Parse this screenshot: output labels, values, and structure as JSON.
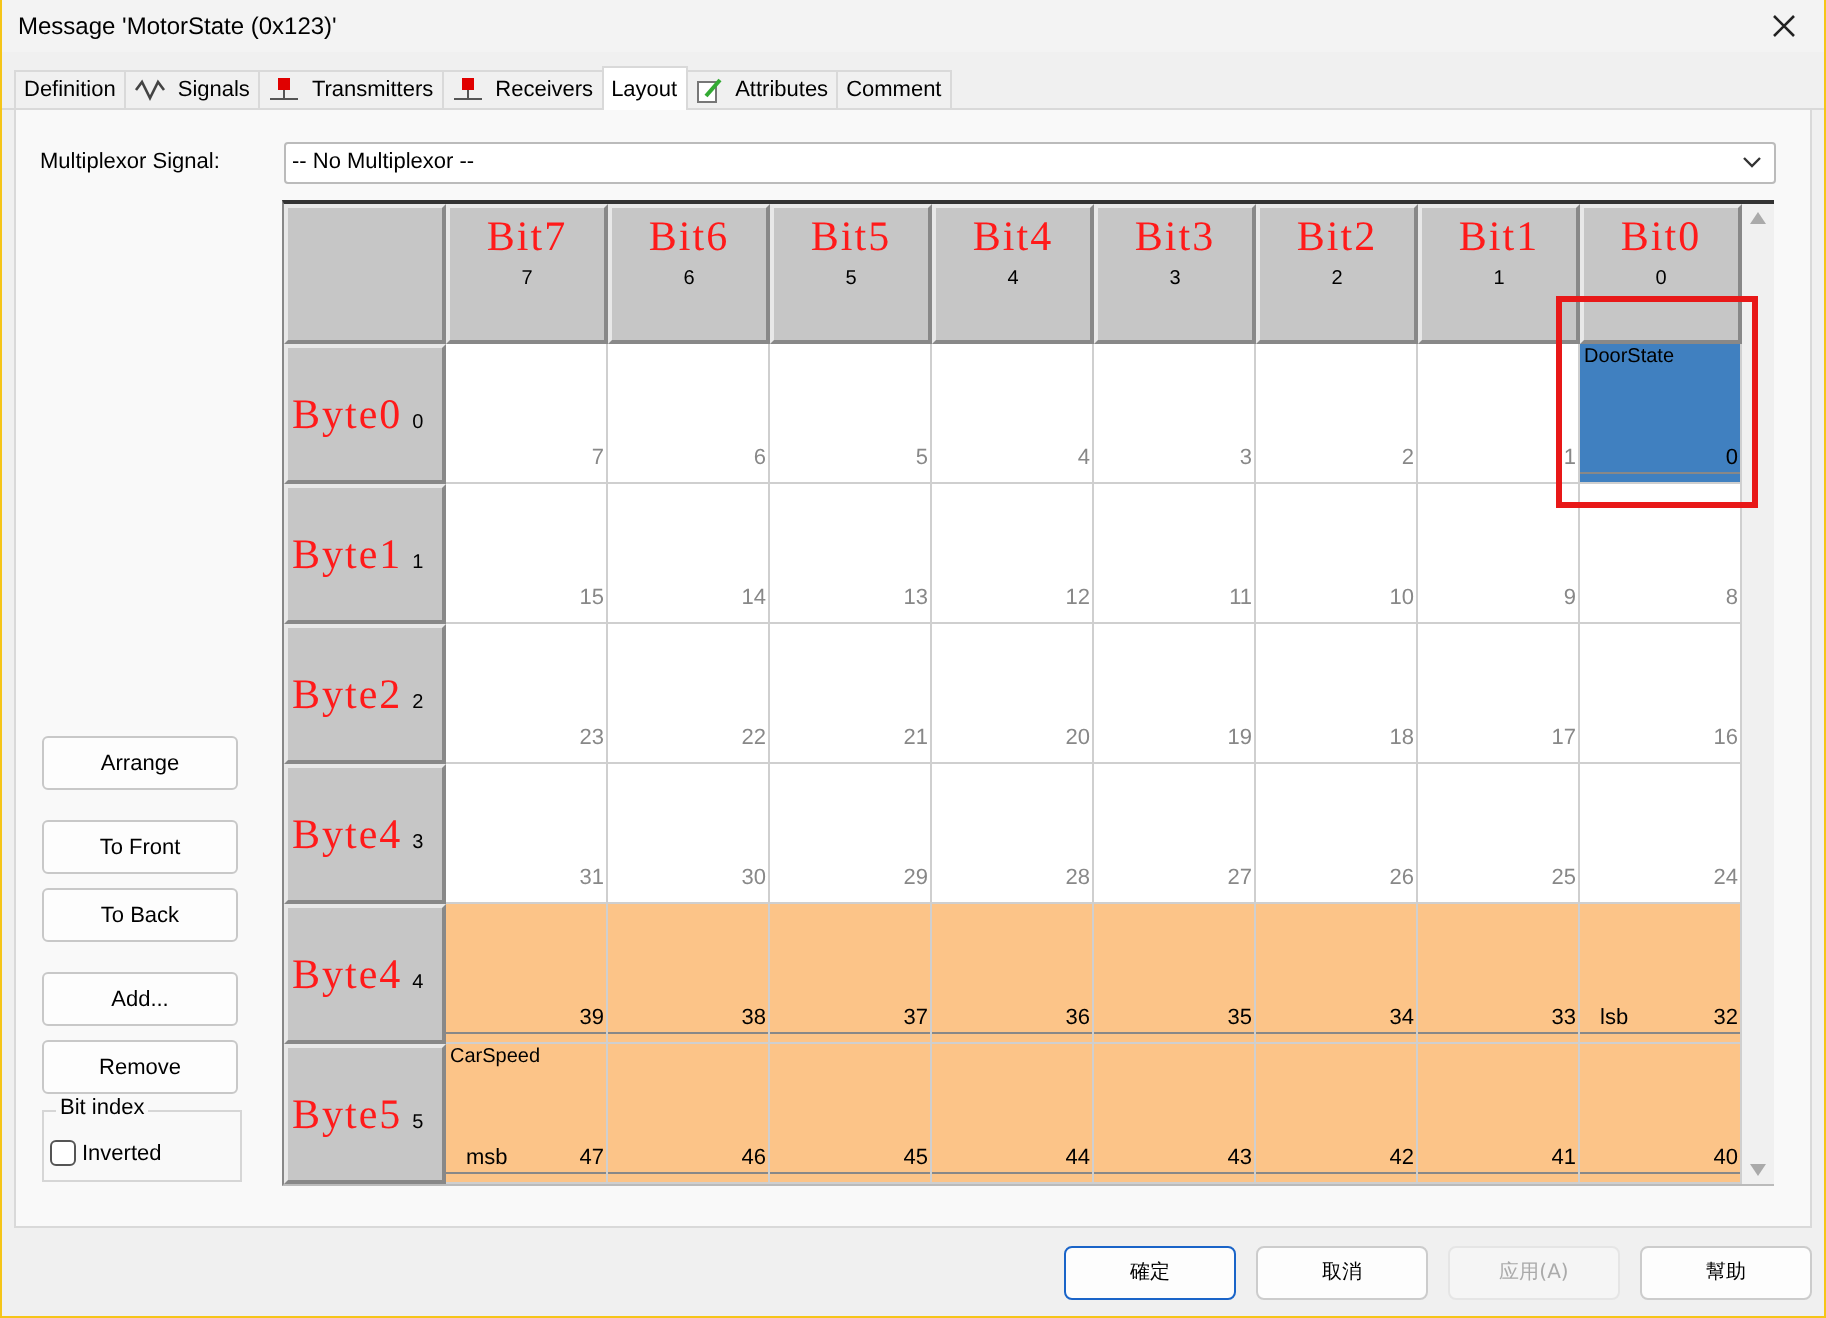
{
  "window": {
    "title": "Message 'MotorState (0x123)'"
  },
  "tabs": [
    {
      "label": "Definition",
      "kind": "plain",
      "selected": false
    },
    {
      "label": "Signals",
      "kind": "signal",
      "selected": false
    },
    {
      "label": "Transmitters",
      "kind": "node",
      "selected": false
    },
    {
      "label": "Receivers",
      "kind": "node",
      "selected": false
    },
    {
      "label": "Layout",
      "kind": "plain",
      "selected": true
    },
    {
      "label": "Attributes",
      "kind": "attribute",
      "selected": false
    },
    {
      "label": "Comment",
      "kind": "plain",
      "selected": false
    }
  ],
  "multiplexor": {
    "label": "Multiplexor Signal:",
    "value": "-- No Multiplexor --"
  },
  "side_buttons": [
    "Arrange",
    "To Front",
    "To Back",
    "Add...",
    "Remove"
  ],
  "bit_index": {
    "title": "Bit index",
    "option": {
      "label": "Inverted",
      "checked": false
    }
  },
  "layout": {
    "columns": [
      {
        "label": "Bit7",
        "index": "7"
      },
      {
        "label": "Bit6",
        "index": "6"
      },
      {
        "label": "Bit5",
        "index": "5"
      },
      {
        "label": "Bit4",
        "index": "4"
      },
      {
        "label": "Bit3",
        "index": "3"
      },
      {
        "label": "Bit2",
        "index": "2"
      },
      {
        "label": "Bit1",
        "index": "1"
      },
      {
        "label": "Bit0",
        "index": "0"
      }
    ],
    "rows": [
      {
        "label": "Byte0",
        "index": "0",
        "cells": [
          {
            "bit": "7"
          },
          {
            "bit": "6"
          },
          {
            "bit": "5"
          },
          {
            "bit": "4"
          },
          {
            "bit": "3"
          },
          {
            "bit": "2"
          },
          {
            "bit": "1"
          },
          {
            "bit": "0",
            "color": "#4080c0",
            "signal": "DoorState",
            "highlighted": true
          }
        ]
      },
      {
        "label": "Byte1",
        "index": "1",
        "cells": [
          {
            "bit": "15"
          },
          {
            "bit": "14"
          },
          {
            "bit": "13"
          },
          {
            "bit": "12"
          },
          {
            "bit": "11"
          },
          {
            "bit": "10"
          },
          {
            "bit": "9"
          },
          {
            "bit": "8"
          }
        ]
      },
      {
        "label": "Byte2",
        "index": "2",
        "cells": [
          {
            "bit": "23"
          },
          {
            "bit": "22"
          },
          {
            "bit": "21"
          },
          {
            "bit": "20"
          },
          {
            "bit": "19"
          },
          {
            "bit": "18"
          },
          {
            "bit": "17"
          },
          {
            "bit": "16"
          }
        ]
      },
      {
        "label": "Byte4",
        "index": "3",
        "cells": [
          {
            "bit": "31"
          },
          {
            "bit": "30"
          },
          {
            "bit": "29"
          },
          {
            "bit": "28"
          },
          {
            "bit": "27"
          },
          {
            "bit": "26"
          },
          {
            "bit": "25"
          },
          {
            "bit": "24"
          }
        ]
      },
      {
        "label": "Byte4",
        "index": "4",
        "cells": [
          {
            "bit": "39",
            "color": "#fcc488"
          },
          {
            "bit": "38",
            "color": "#fcc488"
          },
          {
            "bit": "37",
            "color": "#fcc488"
          },
          {
            "bit": "36",
            "color": "#fcc488"
          },
          {
            "bit": "35",
            "color": "#fcc488"
          },
          {
            "bit": "34",
            "color": "#fcc488"
          },
          {
            "bit": "33",
            "color": "#fcc488"
          },
          {
            "bit": "32",
            "color": "#fcc488",
            "tag": "lsb"
          }
        ]
      },
      {
        "label": "Byte5",
        "index": "5",
        "cells": [
          {
            "bit": "47",
            "color": "#fcc488",
            "signal": "CarSpeed",
            "tag": "msb"
          },
          {
            "bit": "46",
            "color": "#fcc488"
          },
          {
            "bit": "45",
            "color": "#fcc488"
          },
          {
            "bit": "44",
            "color": "#fcc488"
          },
          {
            "bit": "43",
            "color": "#fcc488"
          },
          {
            "bit": "42",
            "color": "#fcc488"
          },
          {
            "bit": "41",
            "color": "#fcc488"
          },
          {
            "bit": "40",
            "color": "#fcc488"
          }
        ]
      }
    ]
  },
  "dialog_buttons": [
    {
      "label": "確定",
      "kind": "default",
      "disabled": false
    },
    {
      "label": "取消",
      "kind": "normal",
      "disabled": false
    },
    {
      "label": "应用(A)",
      "kind": "normal",
      "disabled": true
    },
    {
      "label": "幫助",
      "kind": "normal",
      "disabled": false
    }
  ]
}
